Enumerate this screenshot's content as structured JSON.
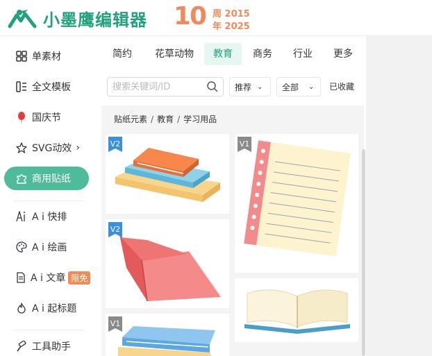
{
  "header": {
    "brand": "小墨鹰编辑器",
    "anniversary_number": "10",
    "anniversary_line1": "周 2015",
    "anniversary_line2": "年 2025"
  },
  "sidebar": {
    "items": [
      {
        "label": "单素材",
        "icon": "grid-icon"
      },
      {
        "label": "全文模板",
        "icon": "template-icon"
      },
      {
        "label": "国庆节",
        "icon": "balloon-icon"
      },
      {
        "label": "SVG动效",
        "icon": "star-icon",
        "chevron": "›"
      },
      {
        "label": "商用贴纸",
        "icon": "puzzle-icon",
        "active": true
      },
      {
        "label": "A i 快排",
        "icon": "ai-icon"
      },
      {
        "label": "A i 绘画",
        "icon": "palette-icon"
      },
      {
        "label": "A i 文章",
        "icon": "document-icon",
        "badge": "限免"
      },
      {
        "label": "A i 起标题",
        "icon": "flame-icon"
      },
      {
        "label": "工具助手",
        "icon": "hammer-icon"
      }
    ]
  },
  "tabs": [
    {
      "label": "简约"
    },
    {
      "label": "花草动物"
    },
    {
      "label": "教育",
      "active": true
    },
    {
      "label": "商务"
    },
    {
      "label": "行业"
    },
    {
      "label": "更多"
    }
  ],
  "search": {
    "placeholder": "搜索关键词/ID",
    "value": ""
  },
  "filters": {
    "sort_label": "推荐",
    "scope_label": "全部",
    "favorites_label": "已收藏"
  },
  "breadcrumb": [
    "贴纸元素",
    "教育",
    "学习用品"
  ],
  "grid": {
    "items": [
      {
        "name": "stacked-books",
        "tag": "V2"
      },
      {
        "name": "notebook-paper",
        "tag": "V1"
      },
      {
        "name": "red-open-book",
        "tag": "V2"
      },
      {
        "name": "open-book",
        "tag": ""
      },
      {
        "name": "blue-book-stack",
        "tag": "V1"
      }
    ]
  },
  "colors": {
    "brand": "#21a17d",
    "active_pill": "#4ebc9b",
    "active_tab_bg": "#e6f6f1",
    "badge": "#f28b54",
    "anniversary": "#f08a5d"
  }
}
